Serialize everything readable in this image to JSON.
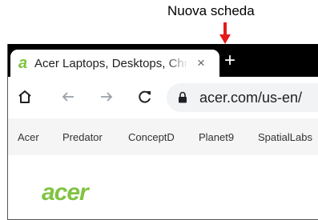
{
  "callout": {
    "label": "Nuova scheda"
  },
  "tab": {
    "favicon": "a",
    "title": "Acer Laptops, Desktops, Chromebooks",
    "close": "×"
  },
  "newtab": {
    "symbol": "+"
  },
  "toolbar": {
    "home_icon": "home-icon",
    "back_icon": "arrow-left-icon",
    "forward_icon": "arrow-right-icon",
    "reload_icon": "reload-icon"
  },
  "omnibox": {
    "lock_icon": "lock-icon",
    "url": "acer.com/us-en/"
  },
  "sitenav": {
    "items": [
      "Acer",
      "Predator",
      "ConceptD",
      "Planet9",
      "SpatialLabs"
    ]
  },
  "content": {
    "logo_text": "acer"
  },
  "colors": {
    "callout_arrow": "#e41b1b",
    "tabstrip": "#000000",
    "acer_green": "#80c342",
    "omnibox_bg": "#f1f3f4",
    "nav_bg": "#f5f5f5"
  }
}
